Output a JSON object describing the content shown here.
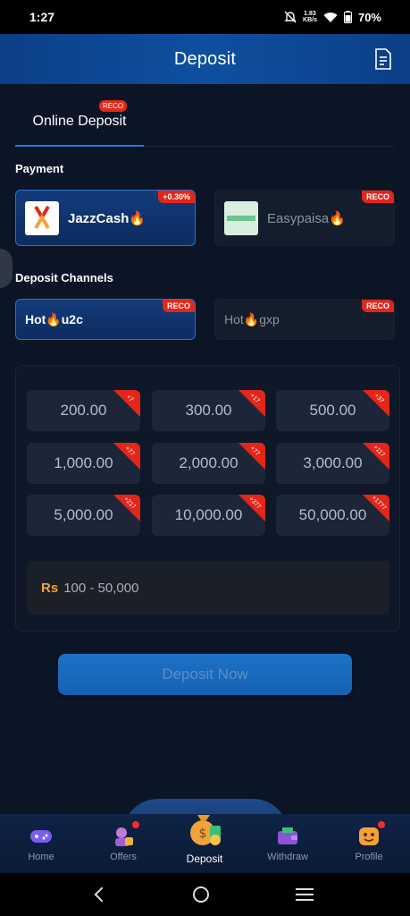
{
  "status": {
    "time": "1:27",
    "net_speed_top": "1.83",
    "net_speed_unit": "KB/s",
    "battery": "70%"
  },
  "header": {
    "title": "Deposit"
  },
  "tabs": [
    {
      "label": "Online Deposit",
      "badge": "RECO"
    }
  ],
  "payment": {
    "label": "Payment",
    "methods": [
      {
        "name": "JazzCash🔥",
        "badge": "+0.30%",
        "logo_text": "JazzCash"
      },
      {
        "name": "Easypaisa🔥",
        "badge": "RECO",
        "logo_text": "easypaisa"
      }
    ]
  },
  "channels": {
    "label": "Deposit Channels",
    "items": [
      {
        "name": "Hot🔥u2c",
        "badge": "RECO"
      },
      {
        "name": "Hot🔥gxp",
        "badge": "RECO"
      }
    ]
  },
  "amounts": [
    {
      "value": "200.00",
      "bonus": "+7"
    },
    {
      "value": "300.00",
      "bonus": "+17"
    },
    {
      "value": "500.00",
      "bonus": "+37"
    },
    {
      "value": "1,000.00",
      "bonus": "+77"
    },
    {
      "value": "2,000.00",
      "bonus": "+77"
    },
    {
      "value": "3,000.00",
      "bonus": "+117"
    },
    {
      "value": "5,000.00",
      "bonus": "+217"
    },
    {
      "value": "10,000.00",
      "bonus": "+377"
    },
    {
      "value": "50,000.00",
      "bonus": "+1777"
    }
  ],
  "range": {
    "currency": "Rs",
    "text": "100 - 50,000"
  },
  "deposit_button": "Deposit Now",
  "bottom_nav": {
    "home": "Home",
    "offers": "Offers",
    "deposit": "Deposit",
    "withdraw": "Withdraw",
    "profile": "Profile"
  },
  "colors": {
    "accent": "#2e6fd2",
    "badge": "#e3261a",
    "currency": "#f2a23a"
  }
}
